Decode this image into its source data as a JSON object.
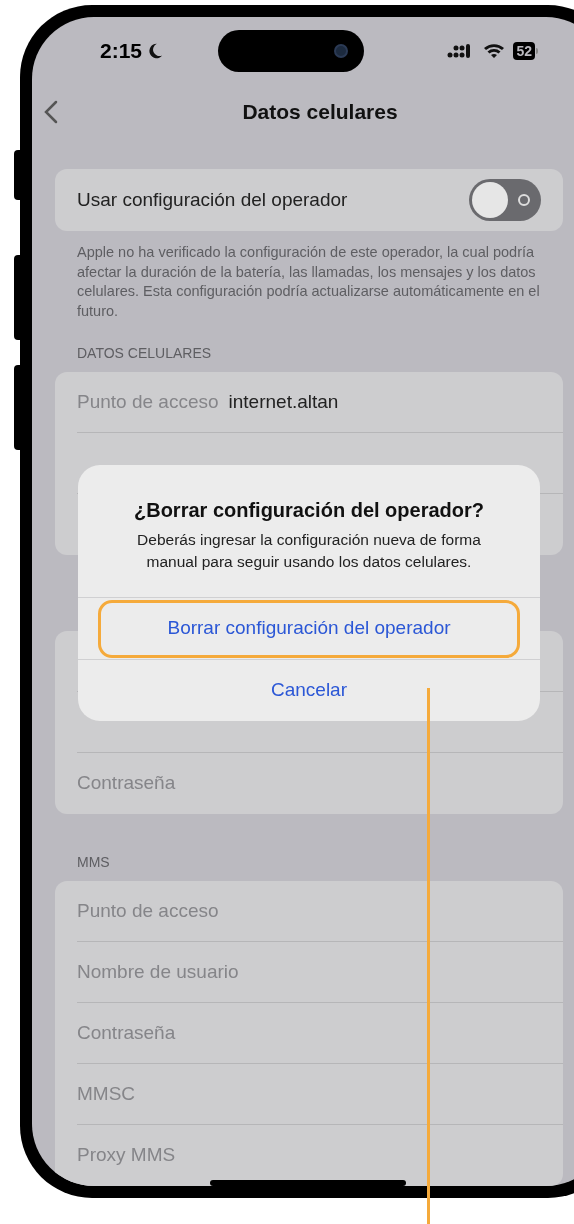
{
  "status_bar": {
    "time": "2:15",
    "battery": "52"
  },
  "nav": {
    "title": "Datos celulares"
  },
  "carrier_toggle": {
    "label": "Usar configuración del operador",
    "on": false
  },
  "carrier_note": "Apple no ha verificado la configuración de este operador, la cual podría afectar la duración de la batería, las llamadas, los mensajes y los datos celulares. Esta configuración podría actualizarse automáticamente en el futuro.",
  "sections": [
    {
      "header": "DATOS CELULARES",
      "rows": [
        {
          "label": "Punto de acceso",
          "value": "internet.altan"
        },
        {
          "label": ""
        },
        {
          "label": ""
        }
      ]
    },
    {
      "rows": [
        {
          "label": ""
        },
        {
          "label": ""
        },
        {
          "label": "Contraseña"
        }
      ]
    },
    {
      "header": "MMS",
      "rows": [
        {
          "label": "Punto de acceso"
        },
        {
          "label": "Nombre de usuario"
        },
        {
          "label": "Contraseña"
        },
        {
          "label": "MMSC"
        },
        {
          "label": "Proxy MMS"
        }
      ]
    }
  ],
  "dialog": {
    "title": "¿Borrar configuración del operador?",
    "message": "Deberás ingresar la configuración nueva de forma manual para seguir usando los datos celulares.",
    "actions": [
      {
        "label": "Borrar configuración del operador",
        "highlighted": true
      },
      {
        "label": "Cancelar",
        "highlighted": false
      }
    ]
  }
}
